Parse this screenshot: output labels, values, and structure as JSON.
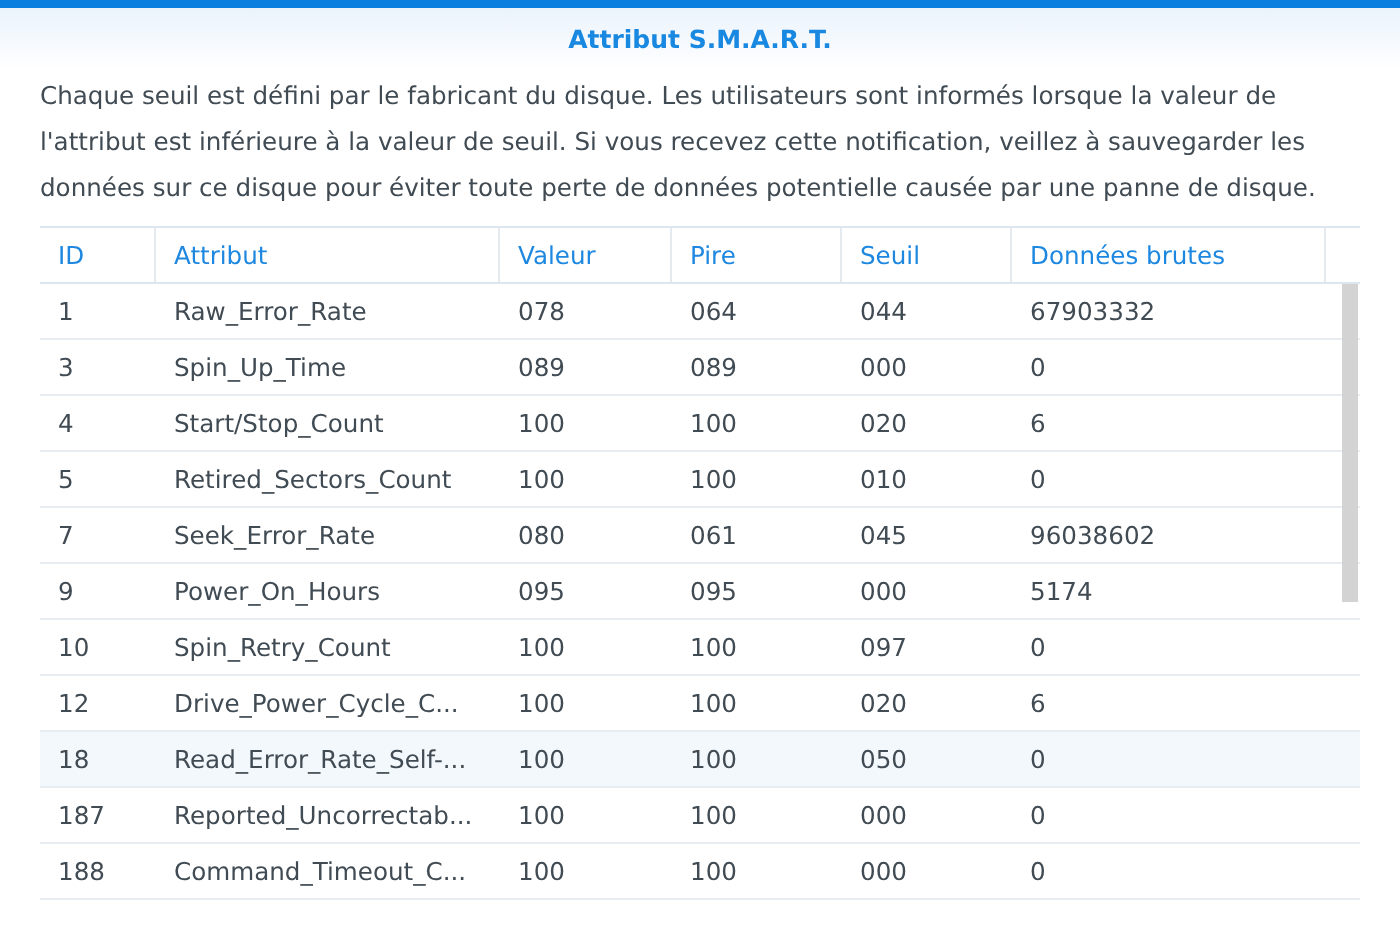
{
  "dialog": {
    "title": "Attribut S.M.A.R.T.",
    "description": "Chaque seuil est défini par le fabricant du disque. Les utilisateurs sont informés lorsque la valeur de l'attribut est inférieure à la valeur de seuil. Si vous recevez cette notification, veillez à sauvegarder les données sur ce disque pour éviter toute perte de données potentielle causée par une panne de disque."
  },
  "table": {
    "columns": [
      "ID",
      "Attribut",
      "Valeur",
      "Pire",
      "Seuil",
      "Données brutes"
    ],
    "rows": [
      {
        "cells": [
          "1",
          "Raw_Error_Rate",
          "078",
          "064",
          "044",
          "67903332"
        ],
        "highlighted": false
      },
      {
        "cells": [
          "3",
          "Spin_Up_Time",
          "089",
          "089",
          "000",
          "0"
        ],
        "highlighted": false
      },
      {
        "cells": [
          "4",
          "Start/Stop_Count",
          "100",
          "100",
          "020",
          "6"
        ],
        "highlighted": false
      },
      {
        "cells": [
          "5",
          "Retired_Sectors_Count",
          "100",
          "100",
          "010",
          "0"
        ],
        "highlighted": false
      },
      {
        "cells": [
          "7",
          "Seek_Error_Rate",
          "080",
          "061",
          "045",
          "96038602"
        ],
        "highlighted": false
      },
      {
        "cells": [
          "9",
          "Power_On_Hours",
          "095",
          "095",
          "000",
          "5174"
        ],
        "highlighted": false
      },
      {
        "cells": [
          "10",
          "Spin_Retry_Count",
          "100",
          "100",
          "097",
          "0"
        ],
        "highlighted": false
      },
      {
        "cells": [
          "12",
          "Drive_Power_Cycle_C...",
          "100",
          "100",
          "020",
          "6"
        ],
        "highlighted": false
      },
      {
        "cells": [
          "18",
          "Read_Error_Rate_Self-...",
          "100",
          "100",
          "050",
          "0"
        ],
        "highlighted": true
      },
      {
        "cells": [
          "187",
          "Reported_Uncorrectab...",
          "100",
          "100",
          "000",
          "0"
        ],
        "highlighted": false
      },
      {
        "cells": [
          "188",
          "Command_Timeout_C...",
          "100",
          "100",
          "000",
          "0"
        ],
        "highlighted": false
      }
    ]
  }
}
